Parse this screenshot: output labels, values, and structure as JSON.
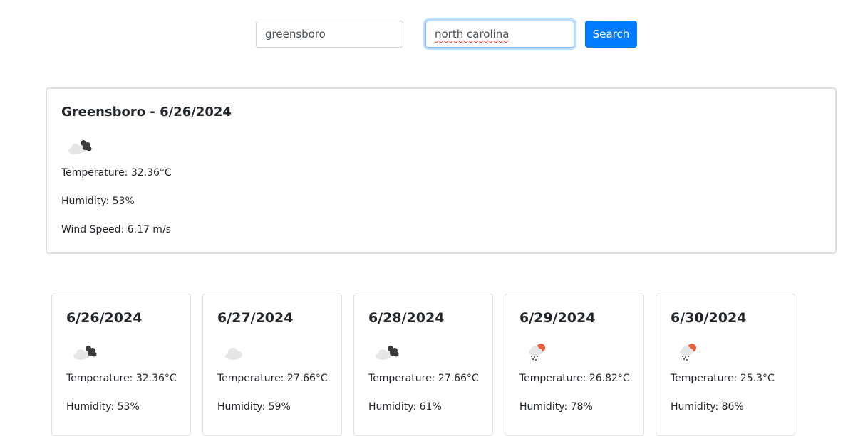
{
  "search": {
    "city_value": "greensboro",
    "state_value": "north carolina",
    "button_label": "Search"
  },
  "current": {
    "title": "Greensboro - 6/26/2024",
    "icon": "broken-clouds-icon",
    "temperature": "Temperature: 32.36°C",
    "humidity": "Humidity: 53%",
    "wind": "Wind Speed: 6.17 m/s"
  },
  "forecast": [
    {
      "date": "6/26/2024",
      "icon": "broken-clouds-icon",
      "temperature": "Temperature: 32.36°C",
      "humidity": "Humidity: 53%"
    },
    {
      "date": "6/27/2024",
      "icon": "few-clouds-icon",
      "temperature": "Temperature: 27.66°C",
      "humidity": "Humidity: 59%"
    },
    {
      "date": "6/28/2024",
      "icon": "broken-clouds-icon",
      "temperature": "Temperature: 27.66°C",
      "humidity": "Humidity: 61%"
    },
    {
      "date": "6/29/2024",
      "icon": "light-rain-icon",
      "temperature": "Temperature: 26.82°C",
      "humidity": "Humidity: 78%"
    },
    {
      "date": "6/30/2024",
      "icon": "light-rain-icon",
      "temperature": "Temperature: 25.3°C",
      "humidity": "Humidity: 86%"
    }
  ],
  "colors": {
    "accent": "#007bff",
    "card_border": "#dfdfdf",
    "sun": "#e8603c",
    "dark_cloud": "#3b3b3b",
    "light_cloud": "#e6e6e6"
  }
}
